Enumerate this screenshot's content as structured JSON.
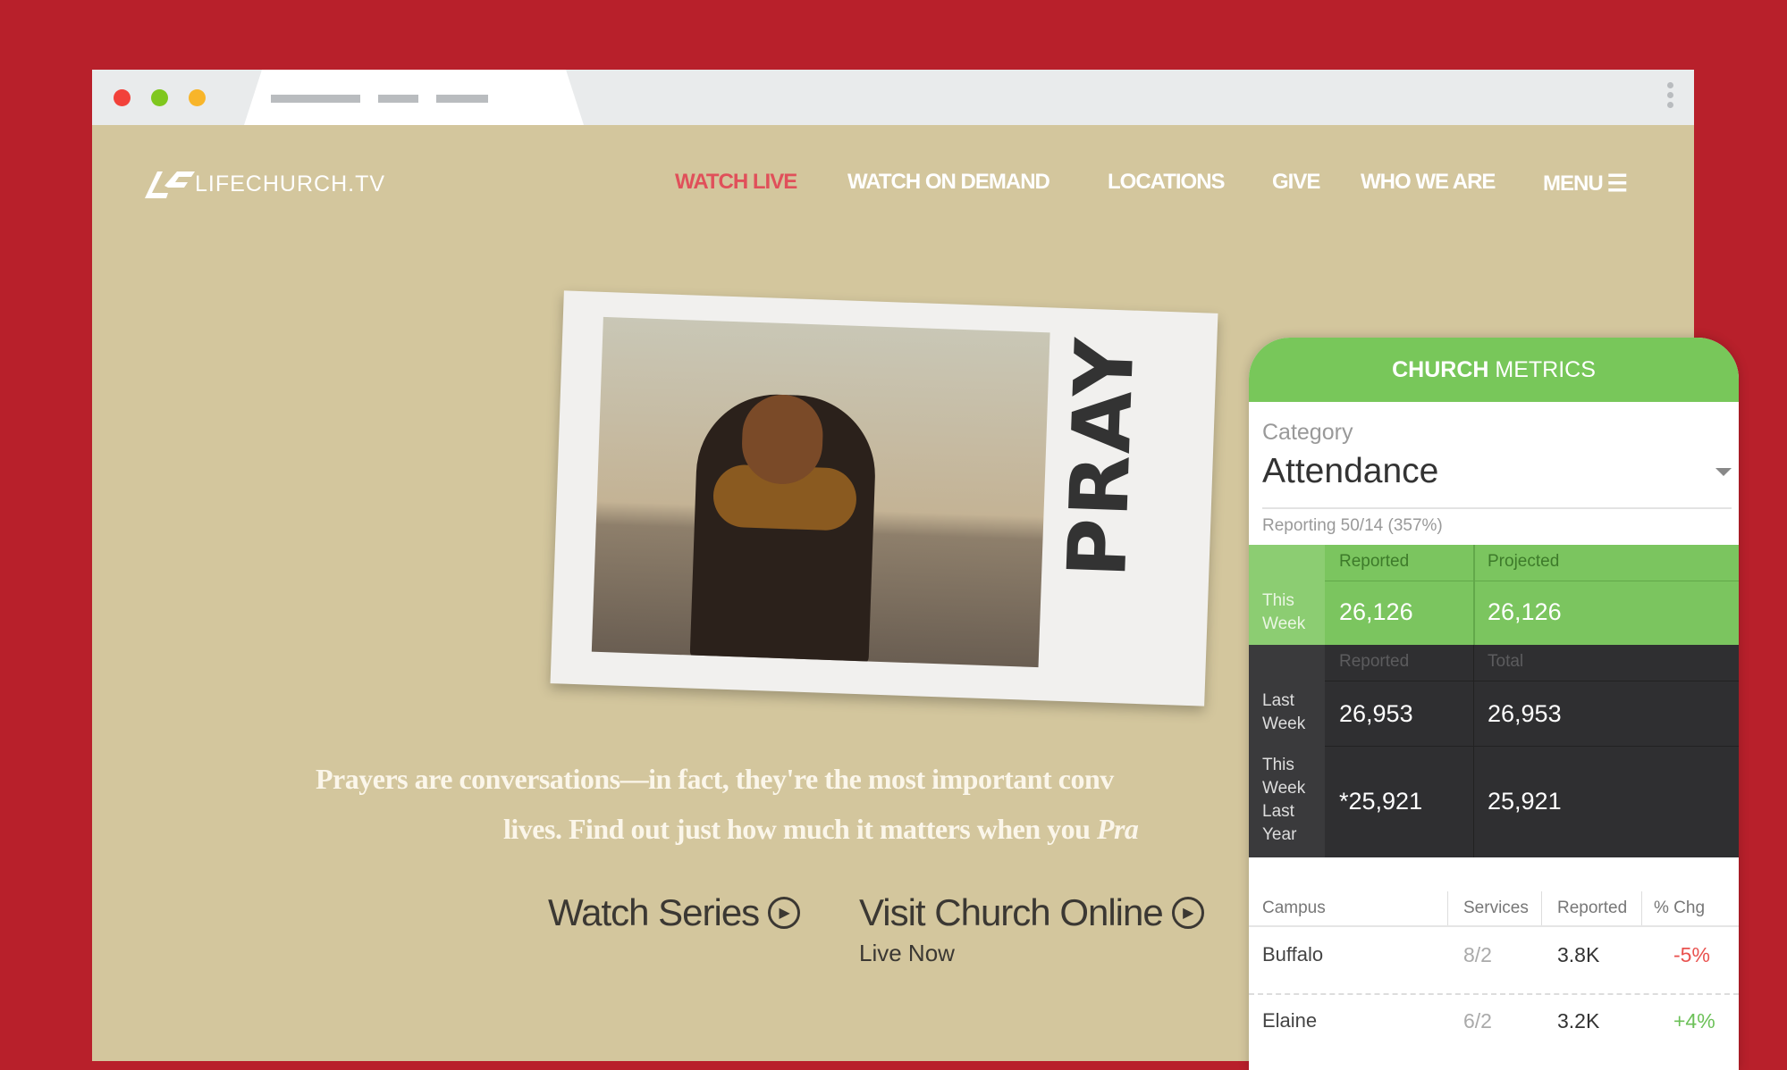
{
  "browser": {
    "colors": {
      "close": "#f2413a",
      "min": "#7fc71e",
      "max": "#f8b52a"
    }
  },
  "site": {
    "logo": "LIFECHURCH.TV",
    "nav": [
      "WATCH LIVE",
      "WATCH ON DEMAND",
      "LOCATIONS",
      "GIVE",
      "WHO WE ARE",
      "MENU"
    ],
    "active_color": "#e0505a"
  },
  "hero": {
    "card_text": "PRAY",
    "line1": "Prayers are conversations—in fact, they're the most important conv",
    "line2_a": "lives. Find out just how much it matters when you ",
    "line2_b": "Pra",
    "watch_series": "Watch Series",
    "visit_online": "Visit Church Online",
    "live_now": "Live Now"
  },
  "metrics": {
    "title_bold": "CHURCH",
    "title_rest": "METRICS",
    "category_label": "Category",
    "category_value": "Attendance",
    "reporting": "Reporting 50/14 (357%)",
    "this_week": {
      "label_1": "This",
      "label_2": "Week",
      "col1": "Reported",
      "col2": "Projected",
      "reported": "26,126",
      "projected": "26,126"
    },
    "dark_headers": {
      "col1": "Reported",
      "col2": "Total"
    },
    "last_week": {
      "label_1": "Last",
      "label_2": "Week",
      "reported": "26,953",
      "total": "26,953"
    },
    "last_year": {
      "label_1": "This",
      "label_2": "Week",
      "label_3": "Last",
      "label_4": "Year",
      "reported": "*25,921",
      "total": "25,921"
    },
    "campus_headers": [
      "Campus",
      "Services",
      "Reported",
      "% Chg"
    ],
    "campuses": [
      {
        "name": "Buffalo",
        "services": "8/2",
        "reported": "3.8K",
        "change": "-5%"
      },
      {
        "name": "Elaine",
        "services": "6/2",
        "reported": "3.2K",
        "change": "+4%"
      }
    ]
  }
}
